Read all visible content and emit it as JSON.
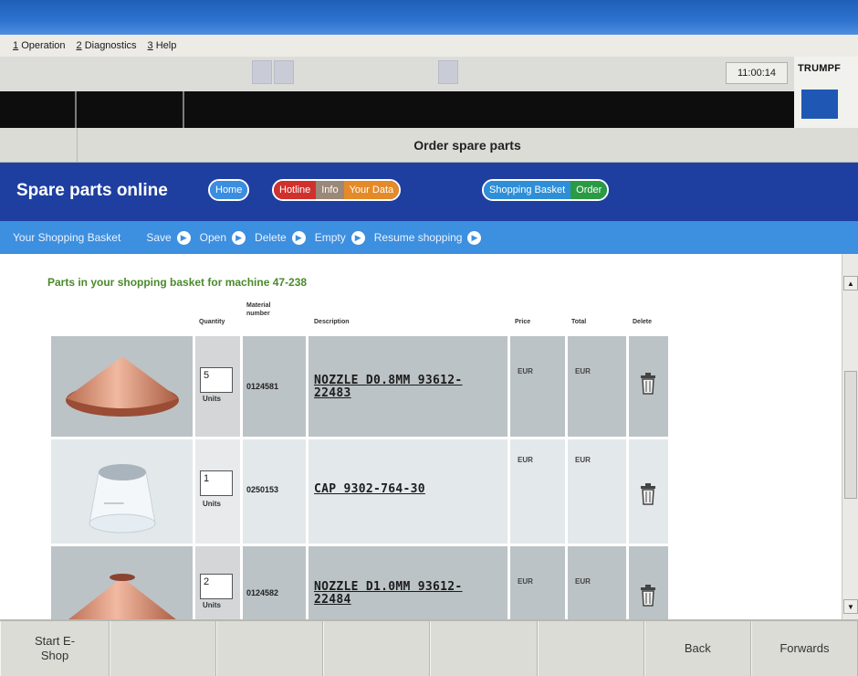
{
  "menu": [
    {
      "key": "1",
      "label": "Operation"
    },
    {
      "key": "2",
      "label": "Diagnostics"
    },
    {
      "key": "3",
      "label": "Help"
    }
  ],
  "clock": "11:00:14",
  "brand": "TRUMPF",
  "page_title": "Order spare parts",
  "site_title": "Spare parts online",
  "nav": {
    "home": "Home",
    "hotline": "Hotline",
    "info": "Info",
    "your_data": "Your Data",
    "shopping_basket": "Shopping Basket",
    "order": "Order"
  },
  "colors": {
    "nav_bg": "#1e3fa0",
    "subnav_bg": "#3d8fdf",
    "heading_green": "#4a8a2a",
    "pill_home": "#3a8ee0",
    "pill_hotline": "#d0312d",
    "pill_info": "#9a8878",
    "pill_yourdata": "#e58a28",
    "pill_basket": "#2e8fd8",
    "pill_order": "#2b9a45"
  },
  "subnav": {
    "basket_label": "Your Shopping Basket",
    "actions": [
      "Save",
      "Open",
      "Delete",
      "Empty",
      "Resume shopping"
    ],
    "action_icon": "circle-arrow-icon"
  },
  "content": {
    "heading": "Parts in your shopping basket for machine 47-238",
    "columns": {
      "quantity": "Quantity",
      "material_number": "Material number",
      "description": "Description",
      "price": "Price",
      "total": "Total",
      "delete": "Delete"
    },
    "rows": [
      {
        "qty": "5",
        "units": "Units",
        "part_no": "0124581",
        "desc": "NOZZLE D0.8MM 93612-22483",
        "price": "EUR",
        "total": "EUR",
        "image": "copper-nozzle-icon",
        "delete_icon": "trash-icon"
      },
      {
        "qty": "1",
        "units": "Units",
        "part_no": "0250153",
        "desc": "CAP 9302-764-30",
        "price": "EUR",
        "total": "EUR",
        "image": "ceramic-cap-icon",
        "delete_icon": "trash-icon"
      },
      {
        "qty": "2",
        "units": "Units",
        "part_no": "0124582",
        "desc": "NOZZLE D1.0MM 93612-22484",
        "price": "EUR",
        "total": "EUR",
        "image": "copper-nozzle-icon",
        "delete_icon": "trash-icon"
      }
    ]
  },
  "fkeys": [
    "Start E-Shop",
    "",
    "",
    "",
    "",
    "",
    "Back",
    "Forwards"
  ]
}
